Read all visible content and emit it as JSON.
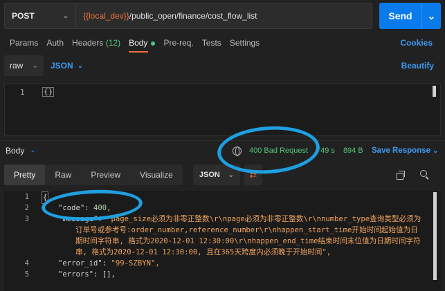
{
  "request": {
    "method": "POST",
    "url_var": "{{local_dev}}",
    "url_path": "/public_open/finance/cost_flow_list",
    "send_label": "Send"
  },
  "tabs": {
    "params": "Params",
    "auth": "Auth",
    "headers": "Headers",
    "headers_count": "(12)",
    "body": "Body",
    "prereq": "Pre-req.",
    "tests": "Tests",
    "settings": "Settings",
    "cookies": "Cookies"
  },
  "body_options": {
    "mode": "raw",
    "format": "JSON",
    "beautify": "Beautify"
  },
  "request_editor": {
    "line_no": "1",
    "content": "{}"
  },
  "response": {
    "title": "Body",
    "status": "400 Bad Request",
    "time": "749 s",
    "size": "894 B",
    "save_label": "Save Response"
  },
  "view": {
    "tabs": [
      "Pretty",
      "Raw",
      "Preview",
      "Visualize"
    ],
    "active": "Pretty",
    "format": "JSON"
  },
  "response_body": {
    "line_numbers": [
      "1",
      "2",
      "3",
      "4",
      "5"
    ],
    "line1": "{",
    "code_key": "\"code\"",
    "code_value": "400,",
    "message_key": "\"message\"",
    "message_line1": "\"page_size必须为非零正整数\\r\\npage必须为非零正整数\\r\\nnumber_type查询类型必须为",
    "message_line2": "订单号或参考号:order_number,reference_number\\r\\nhappen_start_time开始时间起始值为日",
    "message_line3": "期时间字符串, 格式为2020-12-01 12:30:00\\r\\nhappen_end_time结束时间末位值为日期时间字符",
    "message_line4": "串, 格式为2020-12-01 12:30:00, 且在365天跨度内必须晚于开始时间\",",
    "error_id_key": "\"error_id\"",
    "error_id_value": "\"99-SZBYN\",",
    "errors_key": "\"errors\"",
    "errors_value": "[],"
  },
  "colors": {
    "accent_blue": "#097bed",
    "status_green": "#52c77a",
    "string_orange": "#f0a35c",
    "annotation_circle": "#1e9fe0"
  }
}
